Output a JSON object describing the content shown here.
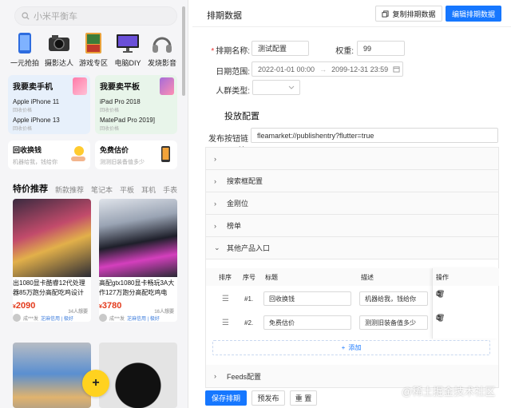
{
  "phone": {
    "search_placeholder": "小米平衡车",
    "categories": [
      {
        "label": "一元抢拍",
        "icon": "phone-icon"
      },
      {
        "label": "摄影达人",
        "icon": "camera-icon"
      },
      {
        "label": "游戏专区",
        "icon": "game-icon"
      },
      {
        "label": "电脑DIY",
        "icon": "monitor-icon"
      },
      {
        "label": "发烧影音",
        "icon": "headphones-icon"
      }
    ],
    "sell_phone": {
      "title": "我要卖手机",
      "items": [
        {
          "name": "Apple iPhone 11",
          "sub": "回收价格"
        },
        {
          "name": "Apple iPhone 13",
          "sub": "回收价格"
        }
      ]
    },
    "sell_tablet": {
      "title": "我要卖平板",
      "items": [
        {
          "name": "iPad Pro 2018",
          "sub": "回收价格"
        },
        {
          "name": "MatePad Pro 2019]",
          "sub": "回收价格"
        }
      ]
    },
    "recycle": {
      "title": "回收换钱",
      "sub": "机器给我，钱给你"
    },
    "estimate": {
      "title": "免费估价",
      "sub": "测测旧装备值多少"
    },
    "tabs": [
      "特价推荐",
      "新款推荐",
      "笔记本",
      "平板",
      "耳机",
      "手表"
    ],
    "products": [
      {
        "name": "出1080显卡酷睿12代处理器85万跑分高配吃鸡设计",
        "price": "2090",
        "currency": "¥",
        "want": "34人想要",
        "seller": "成***发",
        "credit": "芝麻信用 | 极好"
      },
      {
        "name": "高配gtx1080显卡畅玩3A大作127万跑分高配吃鸡电",
        "price": "3780",
        "currency": "¥",
        "want": "16人想要",
        "seller": "成***发",
        "credit": "芝麻信用 | 极好"
      }
    ],
    "fab": "+"
  },
  "panel": {
    "title": "排期数据",
    "copy_btn": "复制排期数据",
    "edit_btn": "编辑排期数据",
    "name_label": "排期名称:",
    "name_value": "测试配置",
    "weight_label": "权重:",
    "weight_value": "99",
    "date_label": "日期范围:",
    "date_start": "2022-01-01 00:00",
    "date_arrow": "→",
    "date_end": "2099-12-31 23:59",
    "crowd_label": "人群类型:",
    "section": "投放配置",
    "publish_label": "发布按钮链接:",
    "publish_value": "fleamarket://publishentry?flutter=true",
    "collapses": [
      "",
      "搜索框配置",
      "金刚位",
      "榜单",
      "其他产品入口"
    ],
    "table": {
      "headers": [
        "排序",
        "序号",
        "标题",
        "描述",
        "操作"
      ],
      "rows": [
        {
          "index": "#1.",
          "title": "回收换钱",
          "desc": "机器给我，钱给你"
        },
        {
          "index": "#2.",
          "title": "免费估价",
          "desc": "测测旧装备值多少"
        }
      ],
      "add": "添加"
    },
    "feeds": "Feeds配置",
    "save": "保存排期",
    "prepublish": "预发布",
    "reset": "重 置",
    "watermark": "@稀土掘金技术社区"
  }
}
